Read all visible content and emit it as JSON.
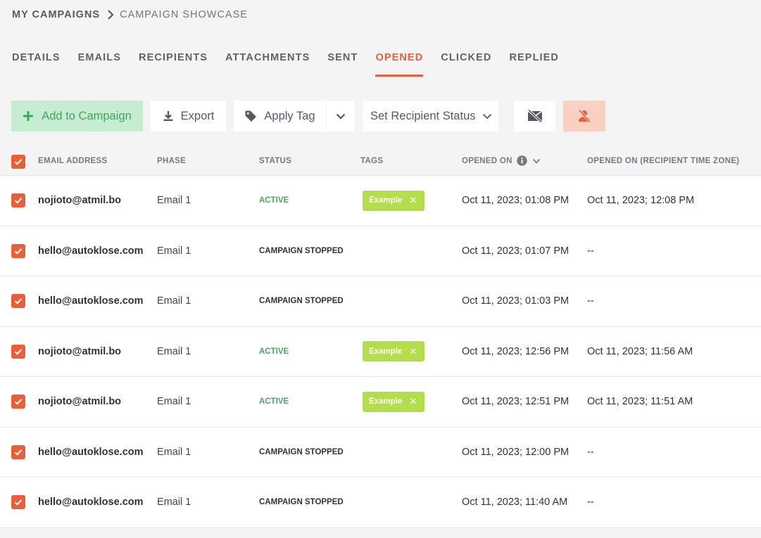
{
  "breadcrumb": {
    "root": "MY CAMPAIGNS",
    "current": "CAMPAIGN SHOWCASE"
  },
  "tabs": [
    {
      "label": "DETAILS"
    },
    {
      "label": "EMAILS"
    },
    {
      "label": "RECIPIENTS"
    },
    {
      "label": "ATTACHMENTS"
    },
    {
      "label": "SENT"
    },
    {
      "label": "OPENED",
      "active": true
    },
    {
      "label": "CLICKED"
    },
    {
      "label": "REPLIED"
    }
  ],
  "toolbar": {
    "add_label": "Add to Campaign",
    "export_label": "Export",
    "apply_tag_label": "Apply Tag",
    "set_status_label": "Set Recipient Status"
  },
  "columns": {
    "email": "EMAIL ADDRESS",
    "phase": "PHASE",
    "status": "STATUS",
    "tags": "TAGS",
    "opened": "OPENED ON",
    "opened_tz": "OPENED ON (RECIPIENT TIME ZONE)"
  },
  "rows": [
    {
      "email": "nojioto@atmil.bo",
      "phase": "Email 1",
      "status": "ACTIVE",
      "tag": "Example",
      "opened": "Oct 11, 2023; 01:08 PM",
      "opened_tz": "Oct 11, 2023; 12:08 PM"
    },
    {
      "email": "hello@autoklose.com",
      "phase": "Email 1",
      "status": "CAMPAIGN STOPPED",
      "tag": "",
      "opened": "Oct 11, 2023; 01:07 PM",
      "opened_tz": "--"
    },
    {
      "email": "hello@autoklose.com",
      "phase": "Email 1",
      "status": "CAMPAIGN STOPPED",
      "tag": "",
      "opened": "Oct 11, 2023; 01:03 PM",
      "opened_tz": "--"
    },
    {
      "email": "nojioto@atmil.bo",
      "phase": "Email 1",
      "status": "ACTIVE",
      "tag": "Example",
      "opened": "Oct 11, 2023; 12:56 PM",
      "opened_tz": "Oct 11, 2023; 11:56 AM"
    },
    {
      "email": "nojioto@atmil.bo",
      "phase": "Email 1",
      "status": "ACTIVE",
      "tag": "Example",
      "opened": "Oct 11, 2023; 12:51 PM",
      "opened_tz": "Oct 11, 2023; 11:51 AM"
    },
    {
      "email": "hello@autoklose.com",
      "phase": "Email 1",
      "status": "CAMPAIGN STOPPED",
      "tag": "",
      "opened": "Oct 11, 2023; 12:00 PM",
      "opened_tz": "--"
    },
    {
      "email": "hello@autoklose.com",
      "phase": "Email 1",
      "status": "CAMPAIGN STOPPED",
      "tag": "",
      "opened": "Oct 11, 2023; 11:40 AM",
      "opened_tz": "--"
    }
  ],
  "icons": {
    "breadcrumb_sep": "chevron-right-icon",
    "add": "plus-icon",
    "export": "download-icon",
    "tag": "tag-icon",
    "caret": "chevron-down-icon",
    "mail_off": "mail-off-icon",
    "user_off": "user-off-icon",
    "info": "info-icon",
    "sort": "chevron-down-icon",
    "check": "check-icon",
    "tag_remove": "close-icon"
  },
  "colors": {
    "accent": "#e95f37",
    "add_bg": "#c6edd2",
    "add_fg": "#3fa65e",
    "danger_bg": "#f9d0c3",
    "active_status": "#4aa561",
    "tag_bg": "#b3dd4a"
  }
}
